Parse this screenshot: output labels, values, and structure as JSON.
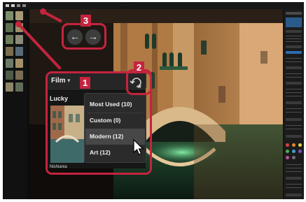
{
  "app": {
    "title_bar_text": "· · · · · · ·"
  },
  "colors": {
    "callout_accent": "#c4243e",
    "panel_bg": "#161616",
    "menu_bg": "#2b2b2b",
    "menu_highlight": "#474747"
  },
  "icons": {
    "undo": "arrow-left-icon",
    "redo": "arrow-right-icon",
    "edit_filter": "refresh-star-icon",
    "pointer": "mouse-cursor-icon",
    "dropdown": "chevron-down-icon"
  },
  "callouts": {
    "one": "1",
    "two": "2",
    "three": "3"
  },
  "history": {
    "undo_glyph": "←",
    "redo_glyph": "→"
  },
  "filter_panel": {
    "category_label": "Film",
    "chevron_glyph": "▾",
    "filter_name": "Lucky",
    "thumb_caption": "Nishiania",
    "menu_items": [
      {
        "label": "Most Used (10)"
      },
      {
        "label": "Custom (0)"
      },
      {
        "label": "Modern (12)"
      },
      {
        "label": "Art (12)"
      }
    ]
  }
}
